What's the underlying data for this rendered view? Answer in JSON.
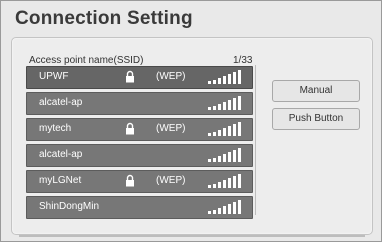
{
  "title": "Connection Setting",
  "header": {
    "label": "Access point name(SSID)",
    "count": "1/33"
  },
  "networks": [
    {
      "ssid": "UPWF",
      "security": "(WEP)",
      "locked": true,
      "selected": true,
      "signal_bars": 5
    },
    {
      "ssid": "alcatel-ap",
      "security": "",
      "locked": false,
      "selected": false,
      "signal_bars": 5
    },
    {
      "ssid": "mytech",
      "security": "(WEP)",
      "locked": true,
      "selected": false,
      "signal_bars": 5
    },
    {
      "ssid": "alcatel-ap",
      "security": "",
      "locked": false,
      "selected": false,
      "signal_bars": 5
    },
    {
      "ssid": "myLGNet",
      "security": "(WEP)",
      "locked": true,
      "selected": false,
      "signal_bars": 5
    },
    {
      "ssid": "ShinDongMin",
      "security": "",
      "locked": false,
      "selected": false,
      "signal_bars": 5
    }
  ],
  "buttons": {
    "manual": "Manual",
    "push": "Push Button"
  },
  "colors": {
    "row_bg": "#777777",
    "selected_row_bg": "#666666",
    "accent_title": "#3a3a3a"
  },
  "icons": {
    "lock": "lock-icon",
    "signal": "wifi-signal-icon"
  }
}
